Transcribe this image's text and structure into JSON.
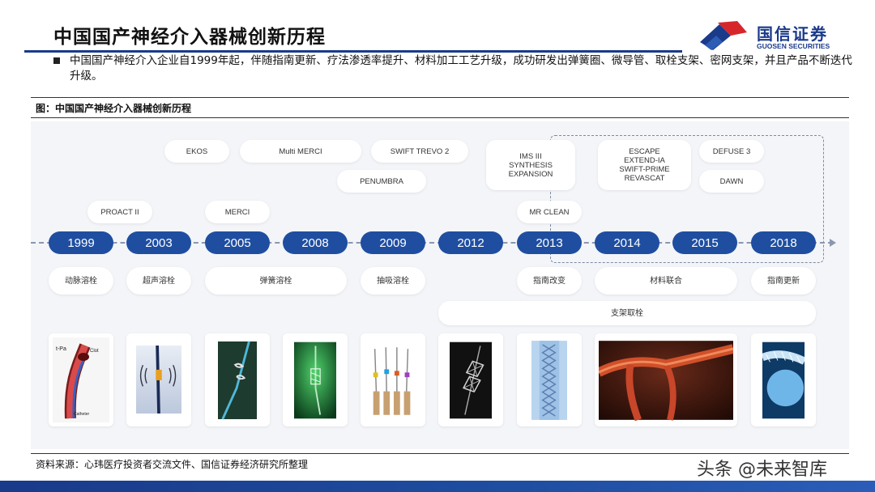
{
  "header": {
    "title": "中国国产神经介入器械创新历程",
    "logo_cn": "国信证券",
    "logo_en": "GUOSEN SECURITIES",
    "logo_colors": {
      "blue": "#1a3a8a",
      "red": "#d7262b"
    }
  },
  "bullet": {
    "text": "中国国产神经介入企业自1999年起，伴随指南更新、疗法渗透率提升、材料加工工艺升级，成功研发出弹簧圈、微导管、取栓支架、密网支架，并且产品不断迭代升级。"
  },
  "figure": {
    "caption": "图：中国国产神经介入器械创新历程",
    "trials_row1": [
      "EKOS",
      "Multi MERCI",
      "SWIFT TREVO 2",
      "IMS III\nSYNTHESIS\nEXPANSION",
      "ESCAPE\nEXTEND-IA\nSWIFT-PRIME\nREVASCAT",
      "DEFUSE 3"
    ],
    "trials_row2": [
      "PENUMBRA",
      "DAWN"
    ],
    "trials_row3": [
      "PROACT II",
      "MERCI",
      "MR CLEAN"
    ],
    "years": [
      "1999",
      "2003",
      "2005",
      "2008",
      "2009",
      "2012",
      "2013",
      "2014",
      "2015",
      "2018"
    ],
    "therapies": [
      "动脉溶栓",
      "超声溶栓",
      "弹簧溶栓",
      "抽吸溶栓",
      "指南改变",
      "材料联合",
      "指南更新"
    ],
    "stent_label": "支架取栓",
    "image_labels": {
      "tpa": "t-Pa",
      "clot": "Clot",
      "catheter": "Catheter"
    },
    "accent_color": "#1f4ea1"
  },
  "footer": {
    "source": "资料来源：心玮医疗投资者交流文件、国信证券经济研究所整理",
    "watermark": "头条 @未来智库"
  }
}
